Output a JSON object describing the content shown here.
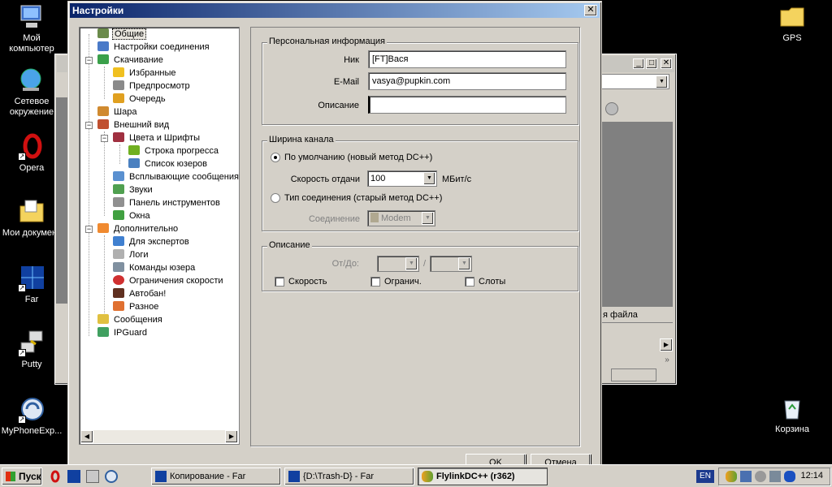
{
  "desktop": {
    "icons": [
      {
        "label": "Мой компьютер"
      },
      {
        "label": "Сетевое окружение"
      },
      {
        "label": "Opera"
      },
      {
        "label": "Мои документ"
      },
      {
        "label": "Far"
      },
      {
        "label": "Putty"
      },
      {
        "label": "MyPhoneExp..."
      },
      {
        "label": "GPS"
      },
      {
        "label": "Корзина"
      }
    ]
  },
  "background_window": {
    "column_header": "я файла"
  },
  "dialog": {
    "title": "Настройки",
    "close_label": "✕",
    "tree": [
      {
        "label": "Общие"
      },
      {
        "label": "Настройки соединения"
      },
      {
        "label": "Скачивание"
      },
      {
        "label": "Избранные"
      },
      {
        "label": "Предпросмотр"
      },
      {
        "label": "Очередь"
      },
      {
        "label": "Шара"
      },
      {
        "label": "Внешний вид"
      },
      {
        "label": "Цвета и Шрифты"
      },
      {
        "label": "Строка прогресса"
      },
      {
        "label": "Список юзеров"
      },
      {
        "label": "Всплывающие сообщения"
      },
      {
        "label": "Звуки"
      },
      {
        "label": "Панель инструментов"
      },
      {
        "label": "Окна"
      },
      {
        "label": "Дополнительно"
      },
      {
        "label": "Для экспертов"
      },
      {
        "label": "Логи"
      },
      {
        "label": "Команды юзера"
      },
      {
        "label": "Ограничения скорости"
      },
      {
        "label": "Автобан!"
      },
      {
        "label": "Разное"
      },
      {
        "label": "Сообщения"
      },
      {
        "label": "IPGuard"
      }
    ],
    "personal": {
      "legend": "Персональная информация",
      "nick_label": "Ник",
      "nick_value": "[FT]Вася",
      "email_label": "E-Mail",
      "email_value": "vasya@pupkin.com",
      "desc_label": "Описание",
      "desc_value": ""
    },
    "bandwidth": {
      "legend": "Ширина канала",
      "default_radio": "По умолчанию (новый метод DC++)",
      "upload_label": "Скорость отдачи",
      "upload_value": "100",
      "upload_unit": "МБит/с",
      "conn_type_radio": "Тип соединения (старый метод DC++)",
      "connection_label": "Соединение",
      "connection_value": "Modem"
    },
    "description": {
      "legend": "Описание",
      "fromto_label": "От/До:",
      "separator": "/",
      "speed_check": "Скорость",
      "limit_check": "Огранич.",
      "slots_check": "Слоты"
    },
    "ok_button": "OK",
    "cancel_button": "Отмена"
  },
  "taskbar": {
    "start_label": "Пуск",
    "tasks": [
      {
        "label": "Копирование - Far"
      },
      {
        "label": "{D:\\Trash-D} - Far"
      },
      {
        "label": "FlylinkDC++ (r362)"
      }
    ],
    "language": "EN",
    "clock": "12:14"
  }
}
